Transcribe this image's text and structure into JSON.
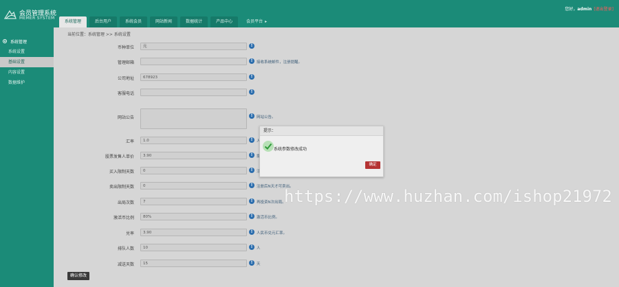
{
  "header": {
    "logo_title": "会员管理系统",
    "logo_subtitle": "MEMER SYSTEM",
    "greeting": "您好，",
    "username": "admin",
    "logout": "[退出登录]"
  },
  "nav": {
    "tabs": [
      {
        "label": "系统管理"
      },
      {
        "label": "后台用户"
      },
      {
        "label": "系统会员"
      },
      {
        "label": "网站新闻"
      },
      {
        "label": "数据统计"
      },
      {
        "label": "产品中心"
      },
      {
        "label": "会员平台"
      }
    ],
    "more_arrow": "▸"
  },
  "sidebar": {
    "heading": "系统管理",
    "items": [
      {
        "label": "系统设置"
      },
      {
        "label": "基础设置"
      },
      {
        "label": "内容设置"
      },
      {
        "label": "数据维护"
      }
    ]
  },
  "breadcrumb": "当前位置：系统管理 >> 系统设置",
  "form": {
    "rows": [
      {
        "label": "币种单位",
        "value": "元",
        "hint": ""
      },
      {
        "label": "管理邮箱",
        "value": "",
        "hint": "接收系统邮件，注册提醒。"
      },
      {
        "label": "公司地址",
        "value": "678923",
        "hint": ""
      },
      {
        "label": "客服电话",
        "value": "",
        "hint": ""
      },
      {
        "label": "网站公告",
        "value": "",
        "hint": "网站公告。"
      },
      {
        "label": "汇率",
        "value": "1.0",
        "hint": "人"
      },
      {
        "label": "股票发售人单价",
        "value": "3.90",
        "hint": "提"
      },
      {
        "label": "买入限制天数",
        "value": "0",
        "hint": "注"
      },
      {
        "label": "卖出限制天数",
        "value": "0",
        "hint": "注册后N天才可卖出。"
      },
      {
        "label": "出局次数",
        "value": "7",
        "hint": "再投资N次出局。"
      },
      {
        "label": "激活币比例",
        "value": "80%",
        "hint": "激活币比例。"
      },
      {
        "label": "兑率",
        "value": "3.90",
        "hint": "人民币兑元汇率。"
      },
      {
        "label": "排队人数",
        "value": "10",
        "hint": "人"
      },
      {
        "label": "减送天数",
        "value": "15",
        "hint": "天"
      }
    ],
    "submit": "确认修改"
  },
  "dialog": {
    "title": "提示：",
    "message": "系统参数修改成功",
    "ok": "确定"
  },
  "watermark": "https://www.huzhan.com/ishop21972",
  "colors": {
    "primary": "#1b8b78",
    "ok_button": "#b53333",
    "hint_icon": "#2b6dad"
  }
}
